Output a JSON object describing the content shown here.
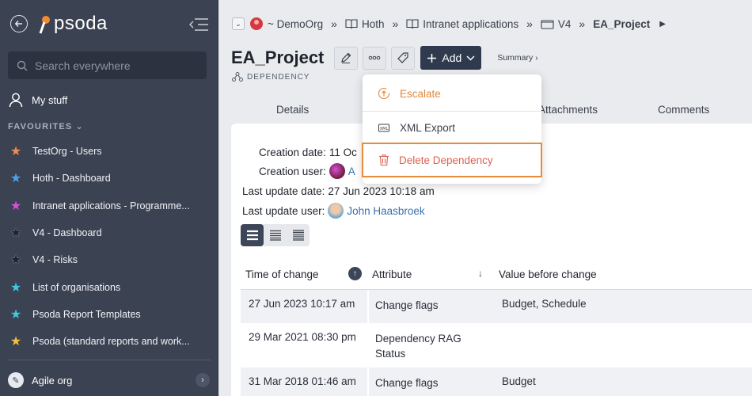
{
  "sidebar": {
    "logo_text": "psoda",
    "search_placeholder": "Search everywhere",
    "my_stuff": "My stuff",
    "favourites_header": "FAVOURITES",
    "favourites": [
      {
        "label": "TestOrg - Users",
        "color": "#f28b4b"
      },
      {
        "label": "Hoth - Dashboard",
        "color": "#4aa3ea"
      },
      {
        "label": "Intranet applications - Programme...",
        "color": "#d94fd8"
      },
      {
        "label": "V4 - Dashboard",
        "color": "#1e2230"
      },
      {
        "label": "V4 - Risks",
        "color": "#1e2230"
      },
      {
        "label": "List of organisations",
        "color": "#3cc9e0"
      },
      {
        "label": "Psoda Report Templates",
        "color": "#3cc9e0"
      },
      {
        "label": "Psoda (standard reports and work...",
        "color": "#f2c23a"
      }
    ],
    "org_label": "Agile org"
  },
  "breadcrumb": {
    "items": [
      "~ DemoOrg",
      "Hoth",
      "Intranet applications",
      "V4"
    ],
    "current": "EA_Project"
  },
  "header": {
    "title": "EA_Project",
    "add_label": "Add",
    "summary_label": "Summary ›",
    "subtitle": "DEPENDENCY"
  },
  "tabs": {
    "details": "Details",
    "attachments": "Attachments",
    "comments": "Comments"
  },
  "meta": {
    "creation_date_label": "Creation date:",
    "creation_date_value": "11 Oc",
    "creation_user_label": "Creation user:",
    "creation_user_value": "A",
    "last_update_date_label": "Last update date:",
    "last_update_date_value": "27 Jun 2023 10:18 am",
    "last_update_user_label": "Last update user:",
    "last_update_user_value": "John Haasbroek"
  },
  "table": {
    "headers": [
      "Time of change",
      "Attribute",
      "Value before change"
    ],
    "rows": [
      {
        "time": "27 Jun 2023 10:17 am",
        "attribute": "Change flags",
        "value": "Budget, Schedule"
      },
      {
        "time": "29 Mar 2021 08:30 pm",
        "attribute": "Dependency RAG Status",
        "value": ""
      },
      {
        "time": "31 Mar 2018 01:46 am",
        "attribute": "Change flags",
        "value": "Budget"
      }
    ]
  },
  "dropdown": {
    "escalate": "Escalate",
    "xml_export": "XML Export",
    "delete": "Delete Dependency"
  }
}
